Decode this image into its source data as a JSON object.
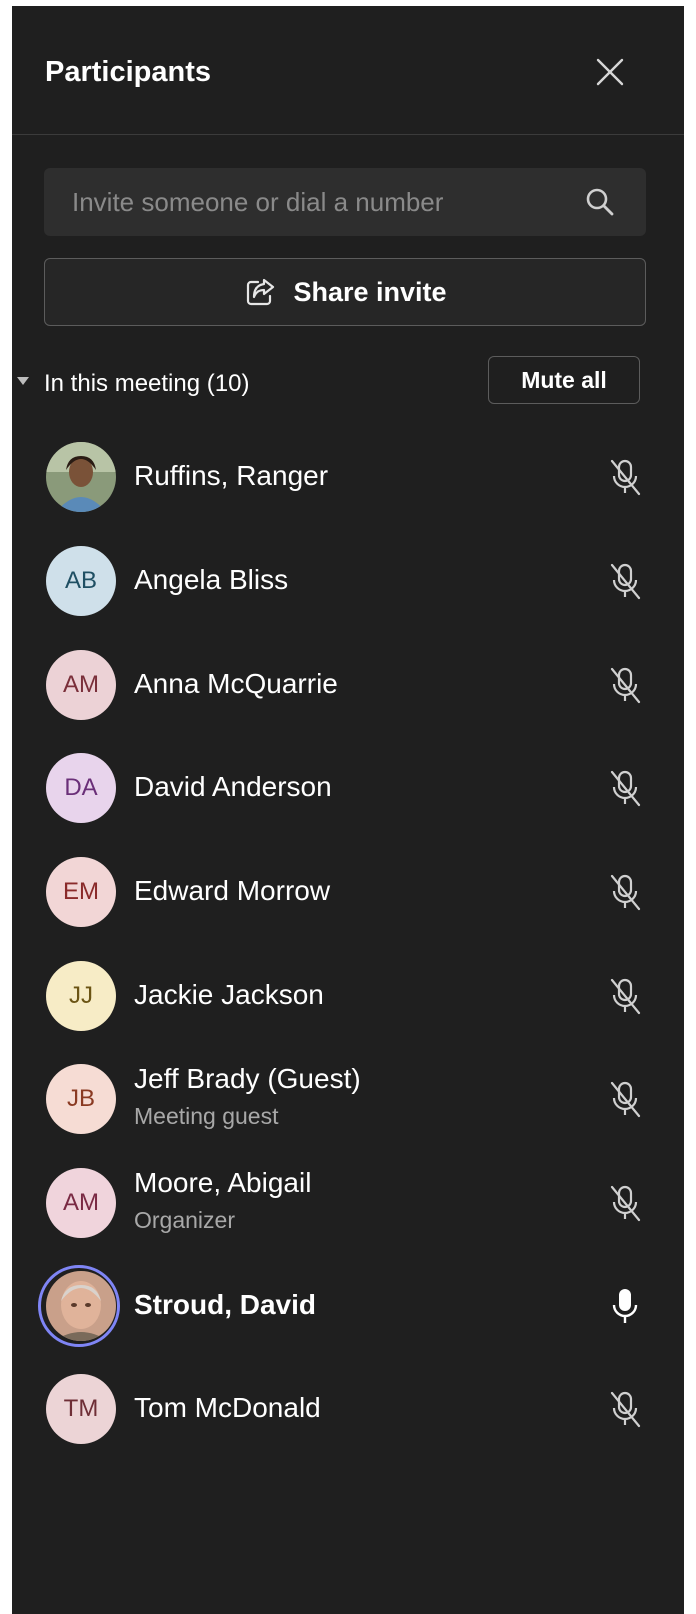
{
  "header": {
    "title": "Participants",
    "close_icon": "close-icon"
  },
  "search": {
    "placeholder": "Invite someone or dial a number",
    "value": "",
    "icon": "search-icon"
  },
  "share": {
    "label": "Share invite",
    "icon": "share-icon"
  },
  "section": {
    "label": "In this meeting (10)",
    "mute_all_label": "Mute all"
  },
  "colors": {
    "panel_bg": "#1f1f1f",
    "speaking_ring": "#7f85f5",
    "subtitle": "#a8a8a8"
  },
  "participants": [
    {
      "name": "Ruffins, Ranger",
      "initials": "",
      "subtitle": "",
      "avatar": "photo",
      "mic": "muted"
    },
    {
      "name": "Angela Bliss",
      "initials": "AB",
      "subtitle": "",
      "avatar_bg": "#cfe0ea",
      "avatar_fg": "#1f4f63",
      "mic": "muted"
    },
    {
      "name": "Anna McQuarrie",
      "initials": "AM",
      "subtitle": "",
      "avatar_bg": "#ecd2d6",
      "avatar_fg": "#7a2f3a",
      "mic": "muted"
    },
    {
      "name": "David Anderson",
      "initials": "DA",
      "subtitle": "",
      "avatar_bg": "#e8d4ec",
      "avatar_fg": "#6a2f78",
      "mic": "muted"
    },
    {
      "name": "Edward Morrow",
      "initials": "EM",
      "subtitle": "",
      "avatar_bg": "#f2d6d6",
      "avatar_fg": "#8a2a2a",
      "mic": "muted"
    },
    {
      "name": "Jackie Jackson",
      "initials": "JJ",
      "subtitle": "",
      "avatar_bg": "#f7ecc6",
      "avatar_fg": "#6b5414",
      "mic": "muted"
    },
    {
      "name": "Jeff Brady (Guest)",
      "initials": "JB",
      "subtitle": "Meeting guest",
      "avatar_bg": "#f6dcd4",
      "avatar_fg": "#8a3a22",
      "mic": "muted"
    },
    {
      "name": "Moore, Abigail",
      "initials": "AM",
      "subtitle": "Organizer",
      "avatar_bg": "#f0d4dc",
      "avatar_fg": "#7a2a44",
      "mic": "muted"
    },
    {
      "name": "Stroud, David",
      "initials": "",
      "subtitle": "",
      "avatar": "photo",
      "mic": "on",
      "speaking": true
    },
    {
      "name": "Tom McDonald",
      "initials": "TM",
      "subtitle": "",
      "avatar_bg": "#ecd4d6",
      "avatar_fg": "#6e2e36",
      "mic": "muted"
    }
  ]
}
